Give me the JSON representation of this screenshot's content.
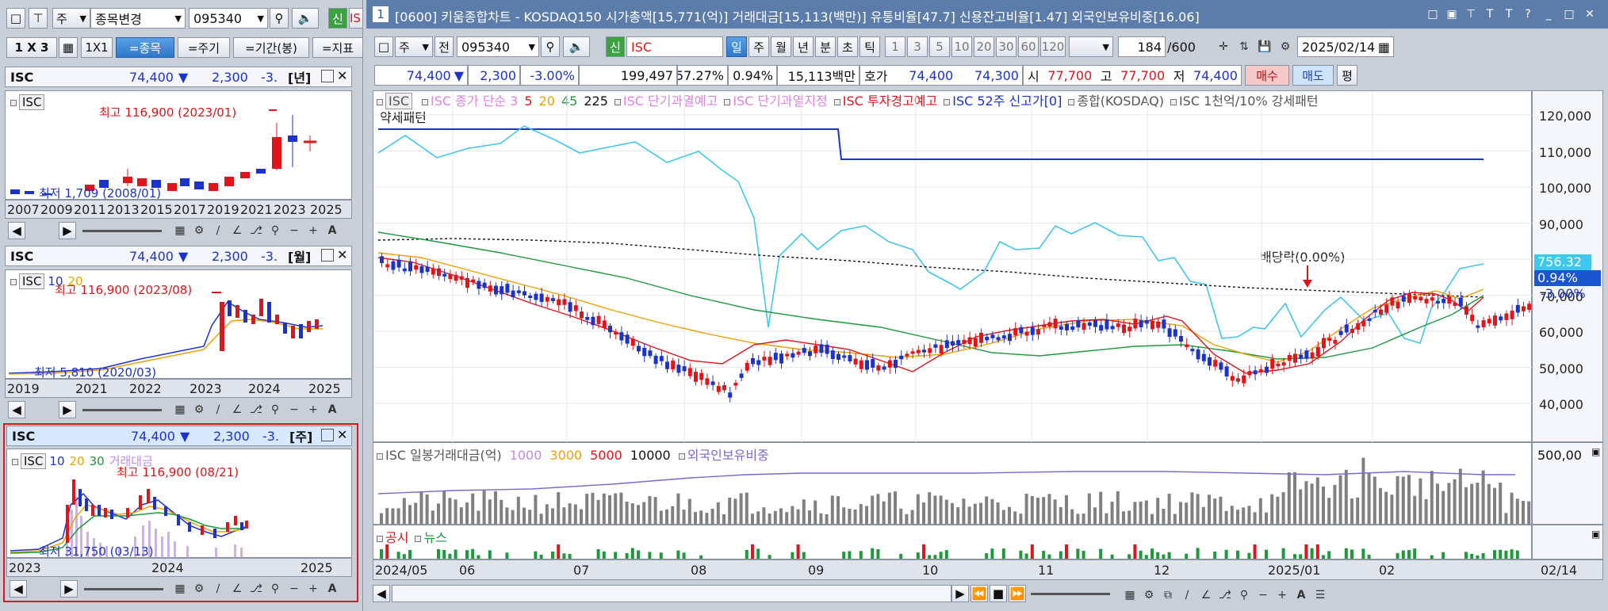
{
  "left": {
    "toolbar": {
      "type": "주",
      "name_change": "종목변경",
      "code": "095340",
      "new_badge": "신",
      "cut_badge": "IS"
    },
    "layout": {
      "grid": "1 X 3",
      "one_by_one": "1X1",
      "stock_btn": "=종목",
      "period_btn": "=주기",
      "range_btn": "=기간(봉)",
      "indicator_btn": "=지표"
    },
    "charts": [
      {
        "name": "ISC",
        "price": "74,400",
        "arrow": "▼",
        "change": "2,300",
        "pct": "-3.",
        "period": "[년]",
        "legend": [
          "ISC"
        ],
        "high_label": "최고 116,900 (2023/01)",
        "low_label": "최저 1,709 (2008/01)",
        "xlabels": [
          "2007",
          "2009",
          "2011",
          "2013",
          "2015",
          "2017",
          "2019",
          "2021",
          "2023",
          "2025"
        ]
      },
      {
        "name": "ISC",
        "price": "74,400",
        "arrow": "▼",
        "change": "2,300",
        "pct": "-3.",
        "period": "[월]",
        "legend": [
          "ISC",
          "10",
          "20"
        ],
        "high_label": "최고 116,900 (2023/08)",
        "low_label": "최저 5,810 (2020/03)",
        "xlabels": [
          "2019",
          "2021",
          "2022",
          "2023",
          "2024",
          "2025"
        ]
      },
      {
        "name": "ISC",
        "price": "74,400",
        "arrow": "▼",
        "change": "2,300",
        "pct": "-3.",
        "period": "[주]",
        "legend": [
          "ISC",
          "10",
          "20",
          "30",
          "거래대금"
        ],
        "high_label": "최고 116,900 (08/21)",
        "low_label": "최저 31,750 (03/13)",
        "xlabels": [
          "2023",
          "2024",
          "2025"
        ]
      }
    ]
  },
  "main": {
    "title": {
      "badge": "1",
      "text": "[0600] 키움종합차트 - KOSDAQ150 시가총액[15,771(억)] 거래대금[15,113(백만)] 유통비율[47.7] 신용잔고비율[1.47] 외국인보유비중[16.06]"
    },
    "toolbar": {
      "type": "주",
      "prev": "전",
      "code": "095340",
      "new_badge": "신",
      "name": "ISC",
      "periods": [
        "일",
        "주",
        "월",
        "년",
        "분",
        "초",
        "틱"
      ],
      "numbers": [
        "1",
        "3",
        "5",
        "10",
        "20",
        "30",
        "60",
        "120"
      ],
      "count": "184",
      "total": "/600",
      "date": "2025/02/14"
    },
    "quote": {
      "price": "74,400",
      "arrow": "▼",
      "change": "2,300",
      "pct": "-3.00%",
      "volume": "199,497",
      "ratio1": "57.27%",
      "ratio2": "0.94%",
      "amount": "15,113백만",
      "hoga_label": "호가",
      "hoga1": "74,400",
      "hoga2": "74,300",
      "open_label": "시",
      "open": "77,700",
      "high_label": "고",
      "high": "77,700",
      "low_label": "저",
      "low": "74,400",
      "buy": "매수",
      "sell": "매도",
      "flat": "평"
    },
    "legend": {
      "items": [
        {
          "text": "ISC",
          "color": "#555555"
        },
        {
          "text": "ISC 종가 단순 3",
          "color": "#e27fe3"
        },
        {
          "text": "5",
          "color": "#e0141a"
        },
        {
          "text": "20",
          "color": "#f0a000"
        },
        {
          "text": "45",
          "color": "#1b9a3a"
        },
        {
          "text": "225",
          "color": "#111111"
        },
        {
          "text": "ISC 단기과열예고",
          "color": "#e27fe3"
        },
        {
          "text": "ISC 단기과열지정",
          "color": "#e27fe3"
        },
        {
          "text": "ISC 투자경고예고",
          "color": "#e0141a"
        },
        {
          "text": "ISC 52주 신고가[0]",
          "color": "#1b32d0"
        },
        {
          "text": "종합(KOSDAQ)",
          "color": "#555555"
        },
        {
          "text": "ISC 1천억/10% 강세패턴",
          "color": "#555555"
        }
      ],
      "line2": "약세패턴"
    },
    "annotation": "배당락(0.00%)",
    "price_axis": [
      "120,000",
      "110,000",
      "100,000",
      "90,000",
      "80,000",
      "70,000",
      "60,000",
      "50,000",
      "40,000"
    ],
    "right_badges": {
      "kosdaq": "756.32",
      "kosdaq_pct": "0.94%",
      "isc_pct": "-3.00%"
    },
    "volume_legend": {
      "title": "ISC 일봉거래대금(억)",
      "levels": [
        {
          "text": "1000",
          "color": "#c18af0"
        },
        {
          "text": "3000",
          "color": "#f0a000"
        },
        {
          "text": "5000",
          "color": "#e0141a"
        },
        {
          "text": "10000",
          "color": "#111111"
        }
      ],
      "foreign": "외국인보유비중"
    },
    "volume_axis": "500,00",
    "news_legend": {
      "notice": "공시",
      "news": "뉴스"
    },
    "x_axis": [
      "2024/05",
      "06",
      "07",
      "08",
      "09",
      "10",
      "11",
      "12",
      "2025/01",
      "02",
      "02/14"
    ],
    "colors": {
      "up": "#e0141a",
      "down": "#1b32d0",
      "kosdaq": "#3fc7ef",
      "ma5": "#e0141a",
      "ma20": "#f0a000",
      "ma45": "#1b9a3a"
    }
  }
}
